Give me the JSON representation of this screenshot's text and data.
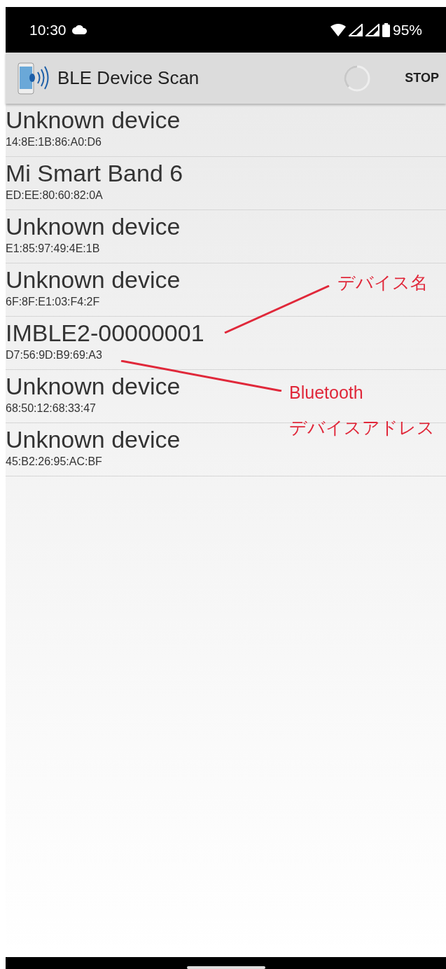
{
  "status_bar": {
    "time": "10:30",
    "battery_percent": "95%"
  },
  "app_bar": {
    "title": "BLE Device Scan",
    "action": "STOP"
  },
  "devices": [
    {
      "name": "Unknown device",
      "address": "14:8E:1B:86:A0:D6"
    },
    {
      "name": "Mi Smart Band 6",
      "address": "ED:EE:80:60:82:0A"
    },
    {
      "name": "Unknown device",
      "address": "E1:85:97:49:4E:1B"
    },
    {
      "name": "Unknown device",
      "address": "6F:8F:E1:03:F4:2F"
    },
    {
      "name": "IMBLE2-00000001",
      "address": "D7:56:9D:B9:69:A3"
    },
    {
      "name": "Unknown device",
      "address": "68:50:12:68:33:47"
    },
    {
      "name": "Unknown device",
      "address": "45:B2:26:95:AC:BF"
    }
  ],
  "annotations": [
    {
      "kind": "name",
      "lines": [
        "デバイス名"
      ]
    },
    {
      "kind": "address",
      "lines": [
        "Bluetooth",
        "デバイスアドレス"
      ]
    }
  ]
}
